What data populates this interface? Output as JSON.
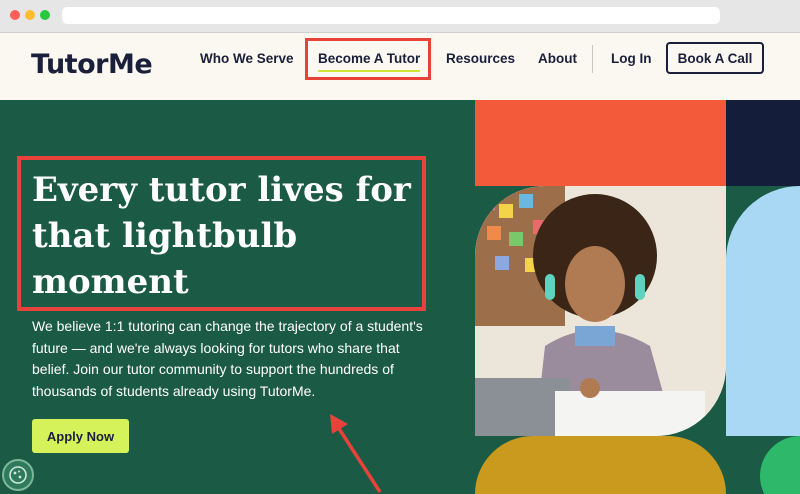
{
  "brand": {
    "logo_text": "TutorMe"
  },
  "nav": {
    "items": [
      {
        "label": "Who We Serve"
      },
      {
        "label": "Become A Tutor"
      },
      {
        "label": "Resources"
      },
      {
        "label": "About"
      },
      {
        "label": "Log In"
      }
    ],
    "cta_label": "Book A Call"
  },
  "hero": {
    "headline": "Every tutor lives for that lightbulb moment",
    "description": "We believe 1:1 tutoring can change the trajectory of a student's future — and we're always looking for tutors who share that belief. Join our tutor community to support the hundreds of thousands of students already using TutorMe.",
    "apply_label": "Apply Now"
  },
  "colors": {
    "hero_bg": "#1b5a45",
    "accent_lime": "#d5f25a",
    "orange": "#f35a3a",
    "navy": "#141d3a",
    "sky": "#a9d8f4",
    "mustard": "#c99a1e",
    "annotation_red": "#e8423a"
  },
  "icons": {
    "cookie_settings": "cookie-icon"
  }
}
